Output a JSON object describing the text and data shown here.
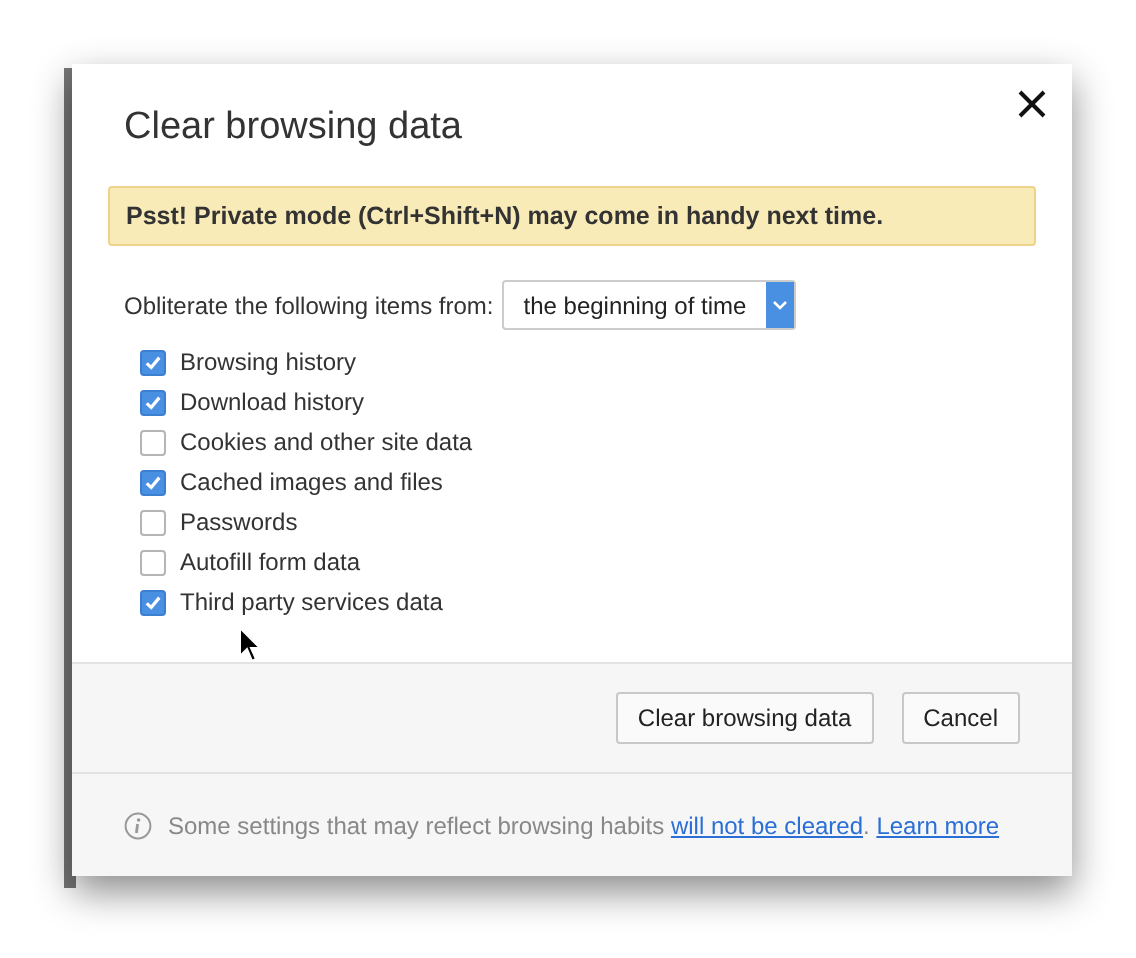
{
  "dialog": {
    "title": "Clear browsing data",
    "banner": "Psst! Private mode (Ctrl+Shift+N) may come in handy next time.",
    "range": {
      "label": "Obliterate the following items from:",
      "value": "the beginning of time"
    },
    "options": [
      {
        "label": "Browsing history",
        "checked": true
      },
      {
        "label": "Download history",
        "checked": true
      },
      {
        "label": "Cookies and other site data",
        "checked": false
      },
      {
        "label": "Cached images and files",
        "checked": true
      },
      {
        "label": "Passwords",
        "checked": false
      },
      {
        "label": "Autofill form data",
        "checked": false
      },
      {
        "label": "Third party services data",
        "checked": true
      }
    ],
    "buttons": [
      "Clear browsing data",
      "Cancel"
    ],
    "footer": [
      {
        "kind": "text",
        "text": "Some settings that may reflect browsing habits "
      },
      {
        "kind": "link",
        "text": "will not be cleared"
      },
      {
        "kind": "text",
        "text": ". "
      },
      {
        "kind": "link",
        "text": "Learn more"
      }
    ]
  }
}
